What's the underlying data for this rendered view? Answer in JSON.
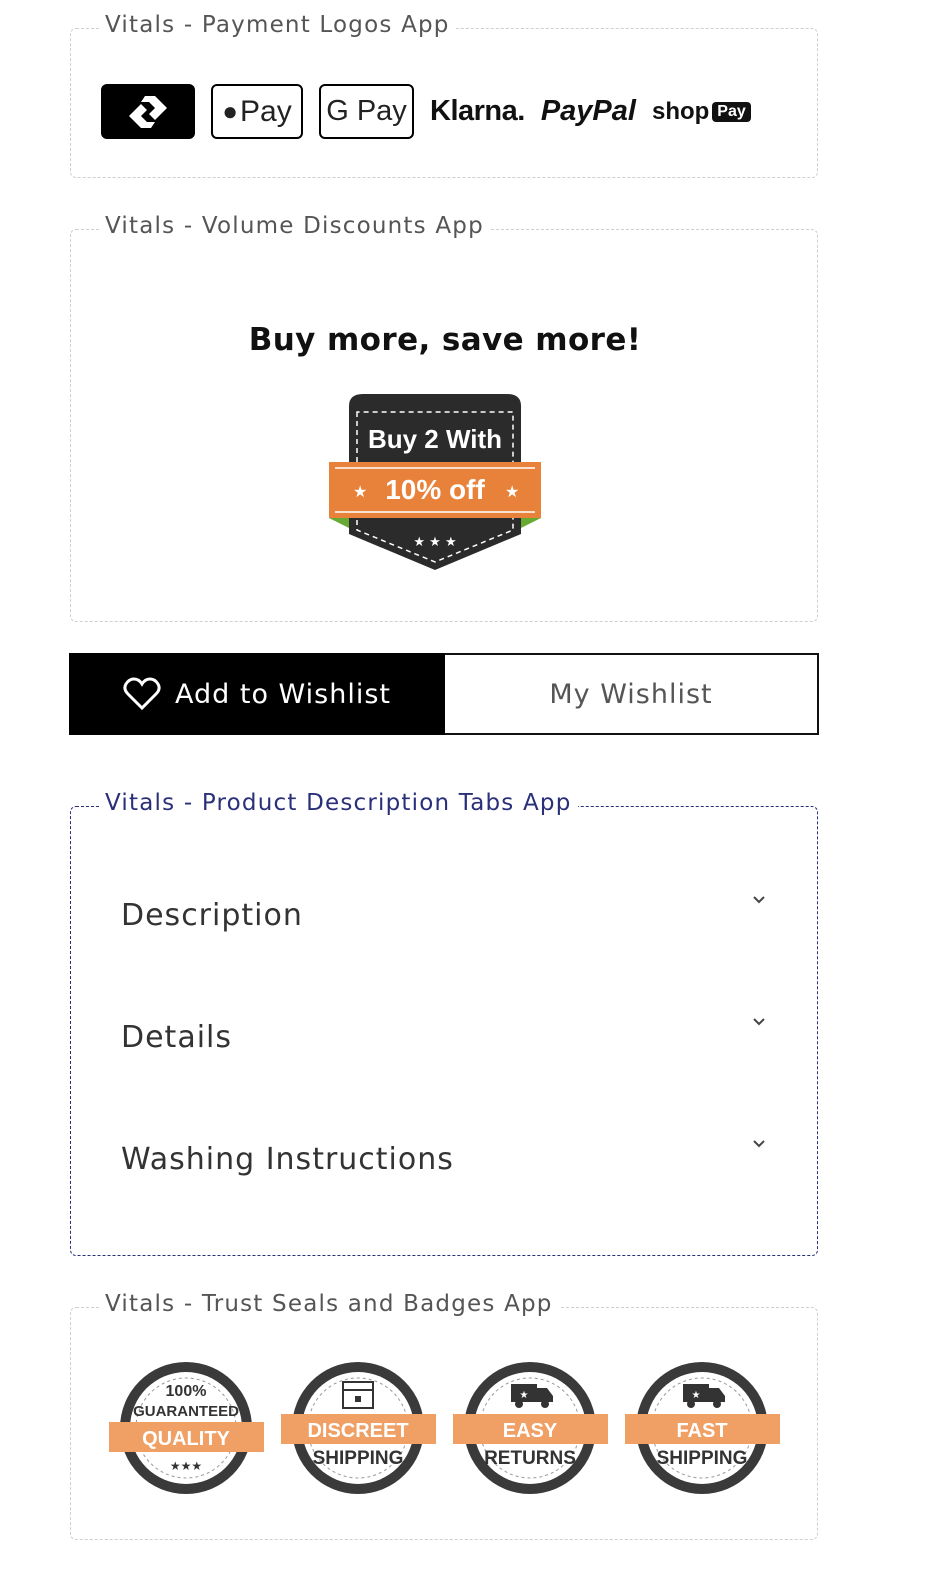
{
  "payment": {
    "legend": "Vitals - Payment Logos App",
    "logos": [
      "link-pay-logo",
      "apple-pay-logo",
      "google-pay-logo",
      "klarna-logo",
      "paypal-logo",
      "shop-pay-logo"
    ],
    "apple_pay": "Pay",
    "google_pay": "G Pay",
    "klarna": "Klarna.",
    "paypal": "PayPal",
    "shop": "shop",
    "shop_pay": "Pay"
  },
  "volume": {
    "legend": "Vitals - Volume Discounts App",
    "headline": "Buy more, save more!",
    "badge_line1": "Buy 2 With",
    "badge_line2": "10% off",
    "accent": "#e8823a"
  },
  "wishlist": {
    "add_label": "Add to Wishlist",
    "my_label": "My Wishlist"
  },
  "tabs": {
    "legend": "Vitals - Product Description Tabs App",
    "items": [
      {
        "label": "Description"
      },
      {
        "label": "Details"
      },
      {
        "label": "Washing Instructions"
      }
    ]
  },
  "trust": {
    "legend": "Vitals - Trust Seals and Badges App",
    "seals": [
      {
        "top": "100%",
        "mid": "GUARANTEED",
        "ribbon": "QUALITY",
        "bottom": "★★★"
      },
      {
        "top": "",
        "mid": "",
        "ribbon": "DISCREET",
        "bottom": "SHIPPING"
      },
      {
        "top": "",
        "mid": "",
        "ribbon": "EASY",
        "bottom": "RETURNS"
      },
      {
        "top": "",
        "mid": "",
        "ribbon": "FAST",
        "bottom": "SHIPPING"
      }
    ],
    "accent": "#f0a064"
  }
}
